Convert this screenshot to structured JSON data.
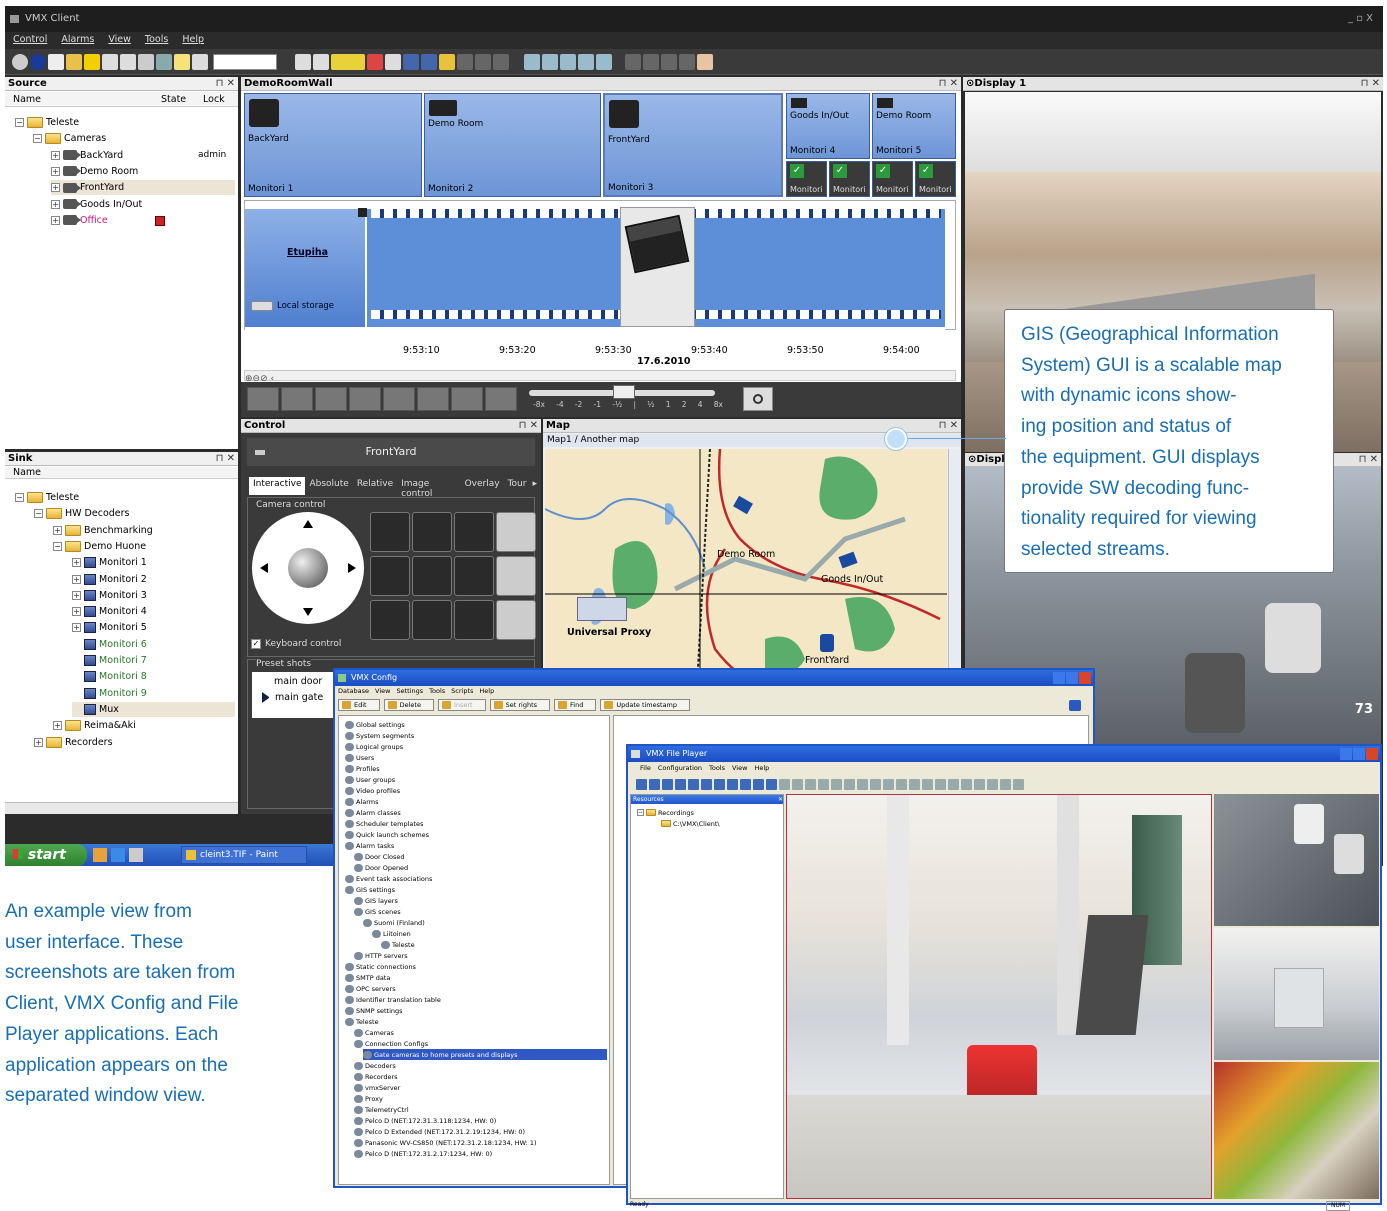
{
  "titlebar": {
    "title": "VMX Client",
    "controls": "_  ▫  X"
  },
  "menubar": [
    "Control",
    "Alarms",
    "View",
    "Tools",
    "Help"
  ],
  "source": {
    "title": "Source",
    "cols": [
      "Name",
      "State",
      "Lock"
    ],
    "items": [
      {
        "label": "Teleste",
        "indent": 0,
        "type": "folder",
        "exp": "−"
      },
      {
        "label": "Cameras",
        "indent": 1,
        "type": "folder",
        "exp": "−"
      },
      {
        "label": "BackYard",
        "indent": 2,
        "type": "ptz",
        "exp": "+",
        "lock": "admin"
      },
      {
        "label": "Demo Room",
        "indent": 2,
        "type": "cam",
        "exp": "+"
      },
      {
        "label": "FrontYard",
        "indent": 2,
        "type": "ptz",
        "exp": "+",
        "selected": true
      },
      {
        "label": "Goods In/Out",
        "indent": 2,
        "type": "cam",
        "exp": "+"
      },
      {
        "label": "Office",
        "indent": 2,
        "type": "cam",
        "exp": "+",
        "color": "#c2187f",
        "alarm": true
      }
    ]
  },
  "sink": {
    "title": "Sink",
    "cols": [
      "Name"
    ],
    "items": [
      {
        "label": "Teleste",
        "indent": 0,
        "type": "folder",
        "exp": "−"
      },
      {
        "label": "HW Decoders",
        "indent": 1,
        "type": "folder",
        "exp": "−"
      },
      {
        "label": "Benchmarking",
        "indent": 2,
        "type": "folder",
        "exp": "+"
      },
      {
        "label": "Demo Huone",
        "indent": 2,
        "type": "folder",
        "exp": "−"
      },
      {
        "label": "Monitori 1",
        "indent": 3,
        "type": "mon",
        "exp": "+"
      },
      {
        "label": "Monitori 2",
        "indent": 3,
        "type": "mon",
        "exp": "+"
      },
      {
        "label": "Monitori 3",
        "indent": 3,
        "type": "mon",
        "exp": "+"
      },
      {
        "label": "Monitori 4",
        "indent": 3,
        "type": "mon",
        "exp": "+"
      },
      {
        "label": "Monitori 5",
        "indent": 3,
        "type": "mon",
        "exp": "+"
      },
      {
        "label": "Monitori 6",
        "indent": 3,
        "type": "mon",
        "color": "#2a7a2a"
      },
      {
        "label": "Monitori 7",
        "indent": 3,
        "type": "mon",
        "color": "#2a7a2a"
      },
      {
        "label": "Monitori 8",
        "indent": 3,
        "type": "mon",
        "color": "#2a7a2a"
      },
      {
        "label": "Monitori 9",
        "indent": 3,
        "type": "mon",
        "color": "#2a7a2a"
      },
      {
        "label": "Mux",
        "indent": 3,
        "type": "mon",
        "selected": true
      },
      {
        "label": "Reima&Aki",
        "indent": 2,
        "type": "folder",
        "exp": "+"
      },
      {
        "label": "Recorders",
        "indent": 1,
        "type": "folder",
        "exp": "+"
      }
    ]
  },
  "wall": {
    "title": "DemoRoomWall",
    "tiles": [
      {
        "cam": "BackYard",
        "mon": "Monitori 1"
      },
      {
        "cam": "Demo Room",
        "mon": "Monitori 2"
      },
      {
        "cam": "FrontYard",
        "mon": "Monitori 3"
      }
    ],
    "small": [
      {
        "cam": "Goods In/Out",
        "mon": "Monitori 4"
      },
      {
        "cam": "Demo Room",
        "mon": "Monitori 5"
      }
    ],
    "mini": [
      "Monitori",
      "Monitori",
      "Monitori",
      "Monitori"
    ]
  },
  "timeline": {
    "name": "Etupiha",
    "storage": "Local storage",
    "ticks": [
      "9:53:10",
      "9:53:20",
      "9:53:30",
      "9:53:40",
      "9:53:50",
      "9:54:00"
    ],
    "date": "17.6.2010",
    "speeds": [
      "-8x",
      "-4",
      "-2",
      "-1",
      "-½",
      "|",
      "½",
      "1",
      "2",
      "4",
      "8x"
    ]
  },
  "control": {
    "title": "Control",
    "camera": "FrontYard",
    "tabs": [
      "Interactive",
      "Absolute",
      "Relative",
      "Image control",
      "Overlay",
      "Tour"
    ],
    "group": "Camera control",
    "keyboard": "Keyboard control",
    "presets_label": "Preset shots",
    "presets": [
      "main door",
      "main gate"
    ]
  },
  "map": {
    "title": "Map",
    "path": "Map1 / Another map",
    "labels": [
      "Demo Room",
      "Goods In/Out",
      "Universal Proxy",
      "FrontYard"
    ]
  },
  "display1": {
    "title": "Display 1",
    "number": "73"
  },
  "display2": {
    "title": "Displa"
  },
  "taskbar": {
    "start": "start",
    "task": "cleint3.TIF - Paint"
  },
  "callout": "GIS (Geographical Information System) GUI is a scalable map with dynamic icons showing position and status of the equipment. GUI displays provide SW decoding functionality required for viewing selected streams.",
  "callout_lines": [
    "GIS (Geographical Information",
    "System) GUI is a scalable map",
    "with dynamic icons show-",
    "ing position and status of",
    "the equipment. GUI displays",
    "provide SW decoding func-",
    "tionality required for viewing",
    "selected streams."
  ],
  "caption_lines": [
    "An example view from",
    "user interface. These",
    "screenshots are taken from",
    "Client, VMX Config and File",
    "Player applications. Each",
    "application appears on the",
    "separated window view."
  ],
  "config": {
    "title": "VMX Config",
    "menu": [
      "Database",
      "View",
      "Settings",
      "Tools",
      "Scripts",
      "Help"
    ],
    "toolbar": [
      "Edit",
      "Delete",
      "Insert",
      "Set rights",
      "Find",
      "Update timestamp"
    ],
    "tree": [
      {
        "l": "Global settings",
        "i": 0
      },
      {
        "l": "System segments",
        "i": 0
      },
      {
        "l": "Logical groups",
        "i": 0
      },
      {
        "l": "Users",
        "i": 0
      },
      {
        "l": "Profiles",
        "i": 0
      },
      {
        "l": "User groups",
        "i": 0
      },
      {
        "l": "Video profiles",
        "i": 0
      },
      {
        "l": "Alarms",
        "i": 0
      },
      {
        "l": "Alarm classes",
        "i": 0
      },
      {
        "l": "Scheduler templates",
        "i": 0
      },
      {
        "l": "Quick launch schemes",
        "i": 0
      },
      {
        "l": "Alarm tasks",
        "i": 0
      },
      {
        "l": "Door Closed",
        "i": 1
      },
      {
        "l": "Door Opened",
        "i": 1
      },
      {
        "l": "Event task associations",
        "i": 0
      },
      {
        "l": "GIS settings",
        "i": 0
      },
      {
        "l": "GIS layers",
        "i": 1
      },
      {
        "l": "GIS scenes",
        "i": 1
      },
      {
        "l": "Suomi (Finland)",
        "i": 2
      },
      {
        "l": "Liitoinen",
        "i": 3
      },
      {
        "l": "Teleste",
        "i": 4
      },
      {
        "l": "HTTP servers",
        "i": 1
      },
      {
        "l": "Static connections",
        "i": 0
      },
      {
        "l": "SMTP data",
        "i": 0
      },
      {
        "l": "OPC servers",
        "i": 0
      },
      {
        "l": "Identifier translation table",
        "i": 0
      },
      {
        "l": "SNMP settings",
        "i": 0
      },
      {
        "l": "Teleste",
        "i": 0
      },
      {
        "l": "Cameras",
        "i": 1
      },
      {
        "l": "Connection Configs",
        "i": 1
      },
      {
        "l": "Gate cameras to home presets and displays",
        "i": 2,
        "sel": true
      },
      {
        "l": "Decoders",
        "i": 1
      },
      {
        "l": "Recorders",
        "i": 1
      },
      {
        "l": "vmxServer",
        "i": 1
      },
      {
        "l": "Proxy",
        "i": 1
      },
      {
        "l": "TelemetryCtrl",
        "i": 1
      },
      {
        "l": "Pelco D (NET:172.31.3.118:1234, HW: 0)",
        "i": 1
      },
      {
        "l": "Pelco D Extended (NET:172.31.2.19:1234, HW: 0)",
        "i": 1
      },
      {
        "l": "Panasonic WV-CS850 (NET:172.31.2.18:1234, HW: 1)",
        "i": 1
      },
      {
        "l": "Pelco D (NET:172.31.2.17:1234, HW: 0)",
        "i": 1
      }
    ]
  },
  "player": {
    "title": "VMX File Player",
    "menu": [
      "File",
      "Configuration",
      "Tools",
      "View",
      "Help"
    ],
    "resources": "Resources",
    "tree": [
      "Recordings",
      "C:\\VMX\\Client\\"
    ],
    "status": "Ready",
    "num": "NUM"
  }
}
